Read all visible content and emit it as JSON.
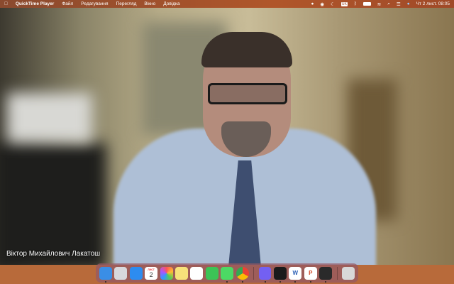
{
  "menubar": {
    "apple": "",
    "app_name": "QuickTime Player",
    "items": [
      "Файл",
      "Редагування",
      "Перегляд",
      "Вікно",
      "Довідка"
    ],
    "datetime": "Чт 2 лист.  08:05",
    "status_icons": [
      "viber-icon",
      "play-icon",
      "moon-icon",
      "keyboard-layout-icon",
      "bluetooth-icon",
      "battery-icon",
      "wifi-icon",
      "search-icon",
      "control-center-icon",
      "siri-icon"
    ],
    "keyboard_layout": "UK"
  },
  "video": {
    "caption": "Віктор Михайлович Лакатош"
  },
  "dock": {
    "apps": [
      {
        "name": "finder",
        "color": "#3a8ee6",
        "running": true
      },
      {
        "name": "launchpad",
        "color": "#d8d8dc",
        "running": false
      },
      {
        "name": "safari",
        "color": "#2d8cf0",
        "running": false
      },
      {
        "name": "calendar",
        "color": "#ffffff",
        "running": false,
        "month": "ЛИСТ",
        "day": "2"
      },
      {
        "name": "photos",
        "color": "#f3f3f3",
        "running": false
      },
      {
        "name": "notes",
        "color": "#f7e27a",
        "running": false
      },
      {
        "name": "freeform",
        "color": "#ffffff",
        "running": false
      },
      {
        "name": "facetime",
        "color": "#3cc456",
        "running": false
      },
      {
        "name": "messages",
        "color": "#4cd964",
        "running": true
      },
      {
        "name": "chrome",
        "color": "#ffffff",
        "running": true
      }
    ],
    "apps2": [
      {
        "name": "viber",
        "color": "#7360f2",
        "running": true
      },
      {
        "name": "activity-monitor",
        "color": "#1b1b1b",
        "running": true
      },
      {
        "name": "word",
        "color": "#ffffff",
        "running": true
      },
      {
        "name": "powerpoint",
        "color": "#ffffff",
        "running": true
      },
      {
        "name": "quicktime",
        "color": "#2a2a2a",
        "running": true
      }
    ],
    "trash": {
      "name": "trash",
      "color": "#d8d8d8"
    }
  }
}
